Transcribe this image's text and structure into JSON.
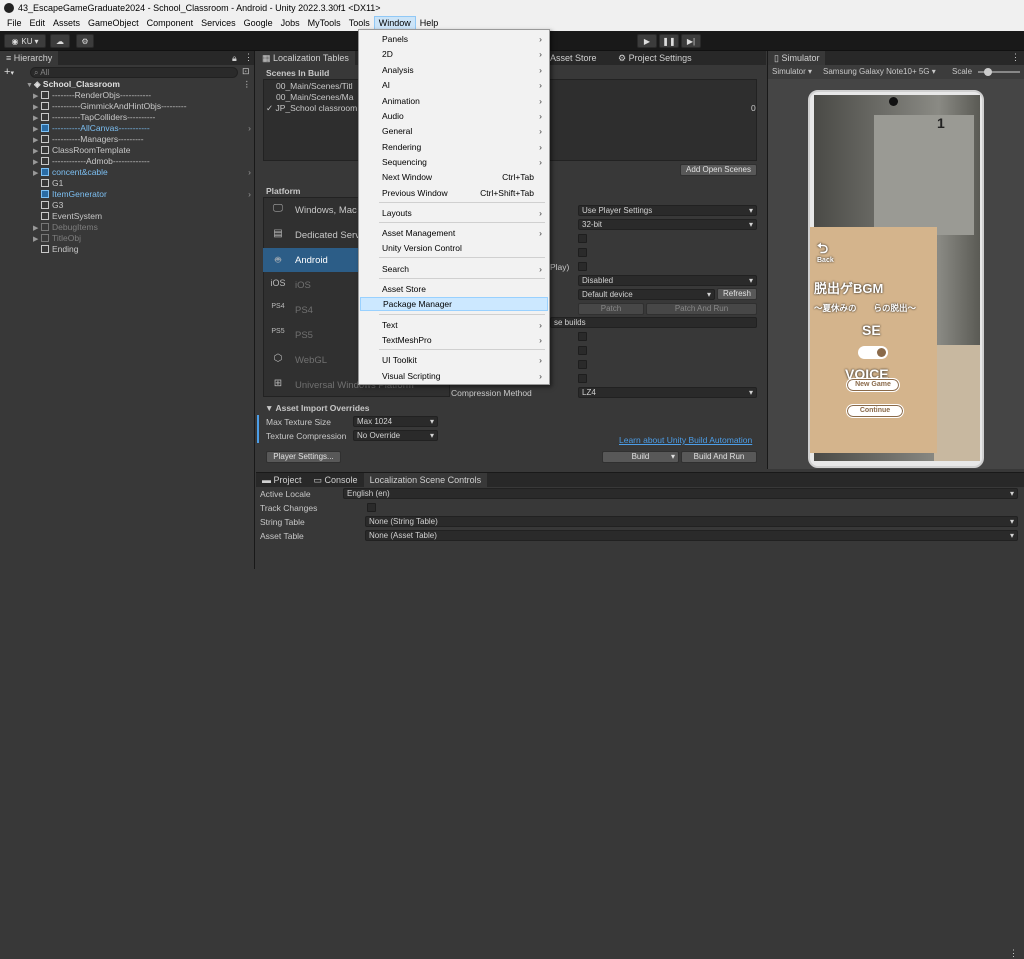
{
  "window": {
    "title": "43_EscapeGameGraduate2024 - School_Classroom - Android - Unity 2022.3.30f1 <DX11>"
  },
  "menubar": [
    "File",
    "Edit",
    "Assets",
    "GameObject",
    "Component",
    "Services",
    "Google",
    "Jobs",
    "MyTools",
    "Tools",
    "Window",
    "Help"
  ],
  "toolbar": {
    "account": "KU"
  },
  "hierarchy": {
    "tab": "Hierarchy",
    "search_placeholder": "All",
    "add": "+",
    "scene": "School_Classroom",
    "items": [
      {
        "label": "--------RenderObjs-----------"
      },
      {
        "label": "----------GimmickAndHintObjs---------"
      },
      {
        "label": "----------TapColliders----------"
      },
      {
        "label": "----------AllCanvas-----------"
      },
      {
        "label": "----------Managers---------"
      },
      {
        "label": "ClassRoomTemplate"
      },
      {
        "label": "------------Admob-------------"
      },
      {
        "label": "concent&cable"
      },
      {
        "label": "G1"
      },
      {
        "label": "ItemGenerator"
      },
      {
        "label": "G3"
      },
      {
        "label": "EventSystem"
      },
      {
        "label": "DebugItems"
      },
      {
        "label": "TitleObj"
      },
      {
        "label": "Ending"
      }
    ]
  },
  "center_tabs": [
    "Localization Tables",
    "Asset Store",
    "Project Settings"
  ],
  "build": {
    "scenes_header": "Scenes In Build",
    "scenes": [
      "00_Main/Scenes/Titl",
      "00_Main/Scenes/Ma",
      "JP_School classroom"
    ],
    "scene_index": "0",
    "add_open_scenes": "Add Open Scenes",
    "platform_header": "Platform",
    "platforms": [
      "Windows, Mac",
      "Dedicated Serv",
      "Android",
      "iOS",
      "PS4",
      "PS5",
      "WebGL",
      "Universal Windows Platform"
    ],
    "settings": {
      "use_player_settings": "Use Player Settings",
      "bits": "32-bit",
      "play": "Play)",
      "disabled": "Disabled",
      "default_device": "Default device",
      "refresh": "Refresh",
      "patch": "Patch",
      "patch_and_run": "Patch And Run",
      "base_builds": "se builds",
      "compression_label": "Compression Method",
      "compression_value": "LZ4"
    },
    "import_overrides": {
      "header": "Asset Import Overrides",
      "max_texture_label": "Max Texture Size",
      "max_texture_value": "Max 1024",
      "tex_compression_label": "Texture Compression",
      "tex_compression_value": "No Override"
    },
    "learn_link": "Learn about Unity Build Automation",
    "player_settings": "Player Settings...",
    "build": "Build",
    "build_and_run": "Build And Run"
  },
  "window_menu": {
    "items": [
      {
        "label": "Panels",
        "sub": true
      },
      {
        "label": "2D",
        "sub": true
      },
      {
        "label": "Analysis",
        "sub": true
      },
      {
        "label": "AI",
        "sub": true
      },
      {
        "label": "Animation",
        "sub": true
      },
      {
        "label": "Audio",
        "sub": true
      },
      {
        "label": "General",
        "sub": true
      },
      {
        "label": "Rendering",
        "sub": true
      },
      {
        "label": "Sequencing",
        "sub": true
      },
      {
        "label": "Next Window",
        "shortcut": "Ctrl+Tab"
      },
      {
        "label": "Previous Window",
        "shortcut": "Ctrl+Shift+Tab"
      },
      {
        "label": "Layouts",
        "sub": true
      },
      {
        "label": "Asset Management",
        "sub": true
      },
      {
        "label": "Unity Version Control"
      },
      {
        "label": "Search",
        "sub": true
      },
      {
        "label": "Asset Store"
      },
      {
        "label": "Package Manager",
        "highlighted": true
      },
      {
        "label": "Text",
        "sub": true
      },
      {
        "label": "TextMeshPro",
        "sub": true
      },
      {
        "label": "UI Toolkit",
        "sub": true
      },
      {
        "label": "Visual Scripting",
        "sub": true
      }
    ]
  },
  "simulator": {
    "tab": "Simulator",
    "mode": "Simulator ▾",
    "device": "Samsung Galaxy Note10+ 5G ▾",
    "scale": "Scale",
    "game": {
      "room_number": "1",
      "back": "Back",
      "title_line1": "脱出ゲBGM",
      "title_line2": "〜夏休みの　　らの脱出〜",
      "se": "SE",
      "voice": "VOICE",
      "new_game": "New Game",
      "continue": "Continue"
    }
  },
  "bottom": {
    "tabs": [
      "Project",
      "Console",
      "Localization Scene Controls"
    ],
    "rows": [
      {
        "label": "Active Locale",
        "value": "English (en)"
      },
      {
        "label": "Track Changes",
        "value": ""
      },
      {
        "label": "String Table",
        "value": "None (String Table)"
      },
      {
        "label": "Asset Table",
        "value": "None (Asset Table)"
      }
    ]
  },
  "colors": {
    "highlight": "#cce8ff",
    "selected_platform": "#2c5d87",
    "link": "#4c9ee8",
    "game_panel": "#d4b48c"
  }
}
